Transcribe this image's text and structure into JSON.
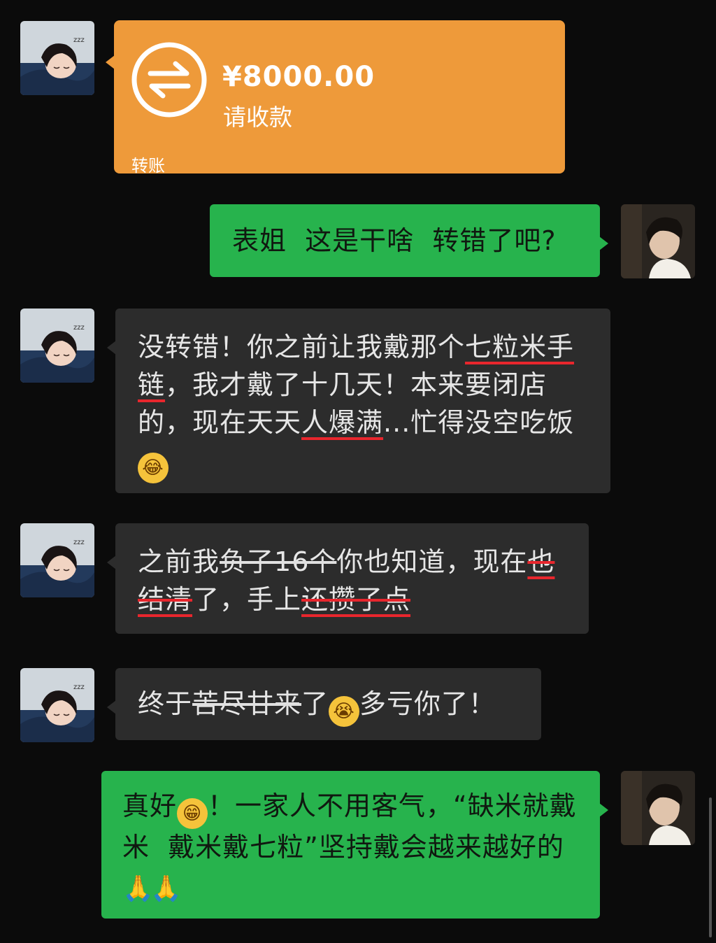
{
  "transfer": {
    "amount": "¥8000.00",
    "note": "请收款",
    "label": "转账",
    "icon": "transfer-arrows-icon",
    "color": "#ee9a3a"
  },
  "messages": [
    {
      "side": "sent",
      "text": "表姐  这是干啥  转错了吧?"
    },
    {
      "side": "recv",
      "parts": [
        "没转错！你之前让我戴那个",
        "七粒米手链",
        "，我才戴了十几天！本来要闭店的，现在天天",
        "人爆满",
        "...忙得没空吃饭"
      ],
      "emoji": "laughing-crying-emoji"
    },
    {
      "side": "recv",
      "parts": [
        "之前我",
        "负了16个",
        "你也知道，现在",
        "也结清",
        "了，手上",
        "还攒了点"
      ]
    },
    {
      "side": "recv",
      "parts": [
        "终于",
        "苦尽甘来",
        "了",
        "多亏你了！"
      ],
      "emoji": "crying-emoji"
    },
    {
      "side": "sent",
      "parts": [
        "真好",
        "！一家人不用客气，“缺米就戴米  戴米戴七粒”坚持戴会越来越好的"
      ],
      "emoji": "grinning-emoji",
      "emoji2": "praying-hands-emoji"
    }
  ],
  "colors": {
    "background": "#0b0b0b",
    "received_bubble": "#2c2c2c",
    "sent_bubble": "#27b34d",
    "annotation_red": "#e8262d"
  }
}
